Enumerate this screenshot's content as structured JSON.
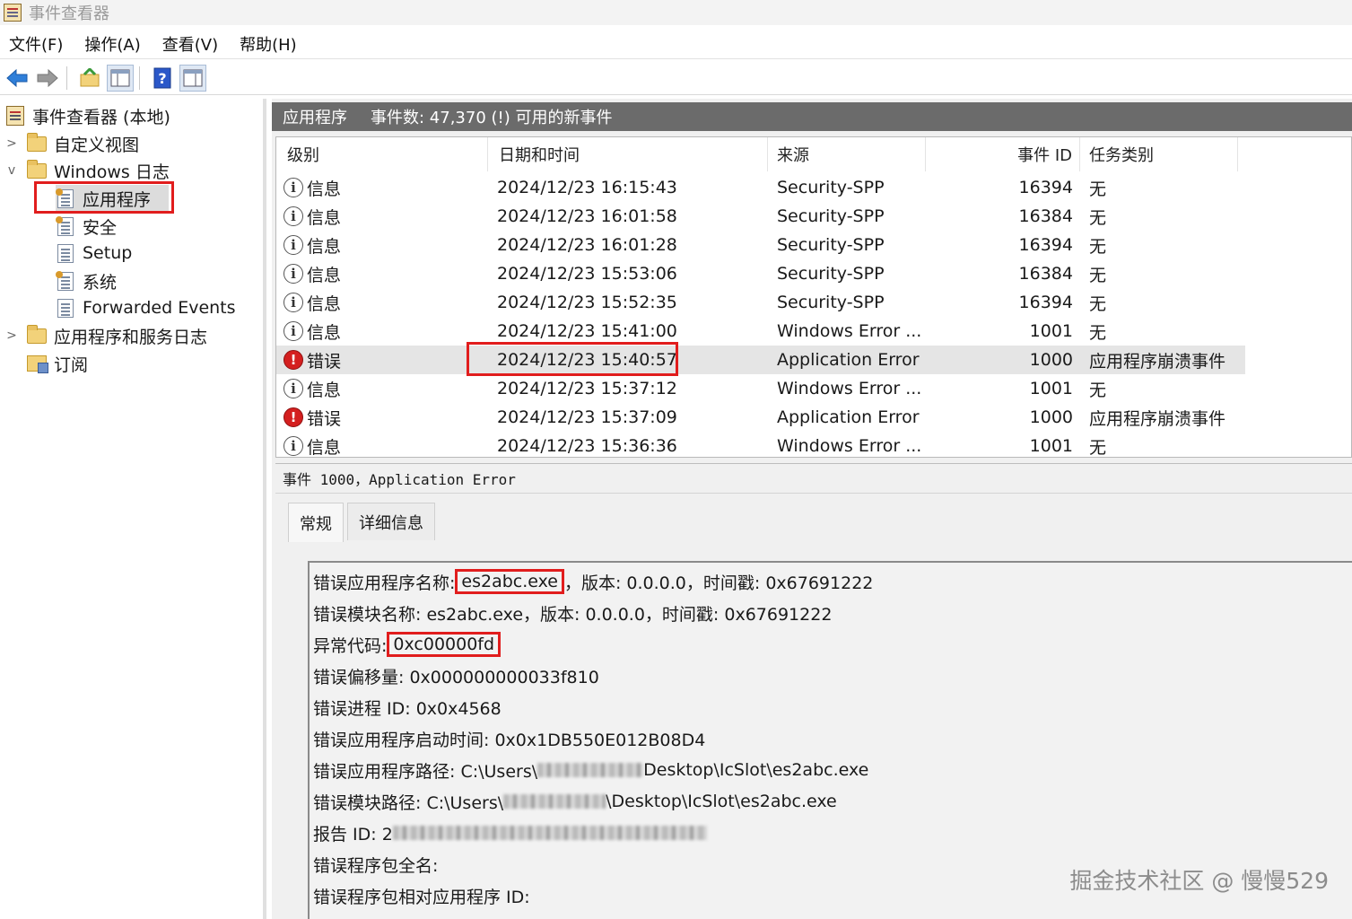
{
  "window": {
    "title": "事件查看器"
  },
  "menu": [
    "文件(F)",
    "操作(A)",
    "查看(V)",
    "帮助(H)"
  ],
  "toolbar": {
    "icons": [
      "back-arrow-icon",
      "forward-arrow-icon",
      "open-folder-icon",
      "console-tree-icon",
      "help-icon",
      "action-pane-icon"
    ],
    "colors": {
      "back_arrow": "#2f7fd9",
      "forward_arrow": "#9a9a9a",
      "help": "#2b58c9"
    }
  },
  "tree": {
    "root": "事件查看器 (本地)",
    "custom_views": "自定义视图",
    "windows_logs": "Windows 日志",
    "application": "应用程序",
    "security": "安全",
    "setup": "Setup",
    "system": "系统",
    "forwarded": "Forwarded Events",
    "app_service_logs": "应用程序和服务日志",
    "subscriptions": "订阅"
  },
  "header": {
    "title": "应用程序",
    "count": "事件数: 47,370 (!) 可用的新事件"
  },
  "columns": {
    "level": "级别",
    "datetime": "日期和时间",
    "source": "来源",
    "event_id": "事件 ID",
    "task": "任务类别"
  },
  "events": [
    {
      "level": "信息",
      "type": "info",
      "datetime": "2024/12/23 16:15:43",
      "source": "Security-SPP",
      "id": "16394",
      "task": "无"
    },
    {
      "level": "信息",
      "type": "info",
      "datetime": "2024/12/23 16:01:58",
      "source": "Security-SPP",
      "id": "16384",
      "task": "无"
    },
    {
      "level": "信息",
      "type": "info",
      "datetime": "2024/12/23 16:01:28",
      "source": "Security-SPP",
      "id": "16394",
      "task": "无"
    },
    {
      "level": "信息",
      "type": "info",
      "datetime": "2024/12/23 15:53:06",
      "source": "Security-SPP",
      "id": "16384",
      "task": "无"
    },
    {
      "level": "信息",
      "type": "info",
      "datetime": "2024/12/23 15:52:35",
      "source": "Security-SPP",
      "id": "16394",
      "task": "无"
    },
    {
      "level": "信息",
      "type": "info",
      "datetime": "2024/12/23 15:41:00",
      "source": "Windows Error ...",
      "id": "1001",
      "task": "无"
    },
    {
      "level": "错误",
      "type": "error",
      "datetime": "2024/12/23 15:40:57",
      "source": "Application Error",
      "id": "1000",
      "task": "应用程序崩溃事件",
      "selected": true
    },
    {
      "level": "信息",
      "type": "info",
      "datetime": "2024/12/23 15:37:12",
      "source": "Windows Error ...",
      "id": "1001",
      "task": "无"
    },
    {
      "level": "错误",
      "type": "error",
      "datetime": "2024/12/23 15:37:09",
      "source": "Application Error",
      "id": "1000",
      "task": "应用程序崩溃事件"
    },
    {
      "level": "信息",
      "type": "info",
      "datetime": "2024/12/23 15:36:36",
      "source": "Windows Error ...",
      "id": "1001",
      "task": "无"
    }
  ],
  "detail": {
    "title": "事件 1000，Application Error",
    "tabs": [
      "常规",
      "详细信息"
    ],
    "line1_label": "错误应用程序名称:",
    "line1_app": "es2abc.exe",
    "line1_rest": "，版本: 0.0.0.0，时间戳: 0x67691222",
    "line2": "错误模块名称: es2abc.exe，版本: 0.0.0.0，时间戳: 0x67691222",
    "line3_label": "异常代码:",
    "line3_code": "0xc00000fd",
    "line4": "错误偏移量: 0x000000000033f810",
    "line5": "错误进程 ID: 0x0x4568",
    "line6": "错误应用程序启动时间: 0x0x1DB550E012B08D4",
    "line7_a": "错误应用程序路径: C:\\Users\\",
    "line7_b": "Desktop\\IcSlot\\es2abc.exe",
    "line8_a": "错误模块路径: C:\\Users\\",
    "line8_b": "\\Desktop\\IcSlot\\es2abc.exe",
    "line9": "报告 ID: 2",
    "line10": "错误程序包全名:",
    "line11": "错误程序包相对应用程序 ID:"
  },
  "watermark": "掘金技术社区 @ 慢慢529",
  "colors": {
    "highlight": "#e11d1d",
    "header_bar": "#6b6b6b",
    "error": "#d41f1f"
  }
}
